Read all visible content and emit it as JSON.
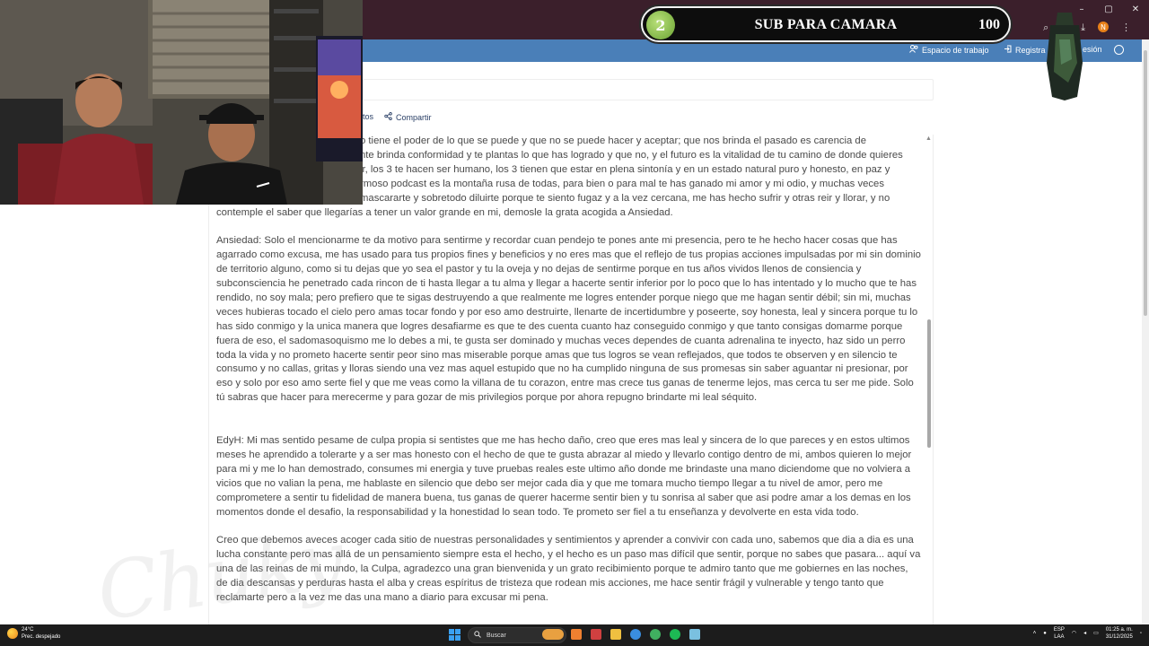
{
  "overlay": {
    "count_left": "2",
    "text": "SUB PARA CAMARA",
    "count_right": "100"
  },
  "appbar": {
    "workspace": "Espacio de trabajo",
    "register": "Registra",
    "signin_suffix": "esión"
  },
  "toolbar": {
    "partial_label": "tos",
    "share": "Compartir"
  },
  "document": {
    "p1_lines": [
      "o tiene el poder de lo que se puede y que no se puede hacer y aceptar; que nos brinda el pasado es carencia de",
      "nte brinda conformidad y te plantas lo que has logrado y que no, y el futuro es la vitalidad de tu camino de donde quieres",
      "ir, los 3 te hacen ser humano, los 3 tienen que estar en plena sintonía y en un estado natural puro y honesto, en paz y",
      "rmoso podcast es la montaña rusa de todas, para bien o para mal te has ganado mi amor y mi odio, y muchas veces",
      "mascararte y sobretodo diluirte porque te siento fugaz y a la vez cercana, me has hecho sufrir y otras reir y llorar, y no",
      "contemple el saber que llegarías a tener un valor grande en mi, demosle la grata acogida a Ansiedad."
    ],
    "p2": "Ansiedad: Solo el mencionarme te da motivo para sentirme y recordar cuan pendejo te pones ante mi presencia, pero te he hecho hacer cosas que has agarrado como excusa, me has usado para tus propios fines y beneficios y no eres mas que el reflejo de tus propias acciones impulsadas por mi sin dominio de territorio alguno, como si tu dejas que yo sea el pastor y tu la oveja y no dejas de sentirme porque en tus años vividos llenos de consiencia y subconsciencia he penetrado cada rincon de ti hasta llegar a tu alma y llegar a hacerte sentir inferior por lo poco que lo has intentado y lo mucho que te has rendido, no soy mala; pero prefiero que te sigas destruyendo a que realmente me logres entender porque niego que me hagan sentir débil; sin mi, muchas veces hubieras tocado el cielo pero amas tocar fondo y por eso amo destruirte, llenarte de incertidumbre y poseerte, soy honesta, leal y sincera porque tu lo has sido conmigo y la unica manera que logres desafiarme es que te des cuenta cuanto haz conseguido conmigo y que tanto consigas domarme porque fuera de eso, el sadomasoquismo me lo debes a mi, te gusta ser dominado y muchas veces dependes de cuanta adrenalina te inyecto, haz sido un perro toda la vida y no prometo hacerte sentir peor sino mas miserable porque amas que tus logros se vean reflejados, que todos te observen y en silencio te consumo y no callas, gritas y lloras siendo una vez mas aquel estupido que no ha cumplido ninguna de sus promesas sin saber aguantar ni presionar, por eso y solo por eso amo serte fiel y que me veas como la villana de tu corazon, entre mas crece tus ganas de tenerme lejos, mas cerca tu ser me pide. Solo tú sabras que hacer para merecerme y para gozar de mis privilegios porque por ahora repugno brindarte mi leal séquito.",
    "p3": "EdyH: Mi mas sentido pesame de culpa propia si sentistes que me has hecho daño, creo que eres mas leal y sincera de lo que pareces y en estos ultimos meses he aprendido a tolerarte y a ser mas honesto con el hecho de que te gusta abrazar al miedo y llevarlo contigo dentro de mi, ambos quieren lo mejor para mi y me lo han demostrado, consumes mi energia y tuve pruebas reales este ultimo año donde me brindaste una mano diciendome que no volviera a vicios que no valian la pena, me hablaste en silencio que debo ser mejor cada dia y que me tomara mucho tiempo llegar a tu nivel de amor, pero me comprometere a sentir tu fidelidad de manera buena, tus ganas de querer hacerme sentir bien y tu sonrisa al saber que asi podre amar a los demas en los momentos donde el desafio, la responsabilidad y la honestidad lo sean todo. Te prometo ser fiel a tu enseñanza y devolverte en esta vida todo.",
    "p4": "Creo que debemos aveces acoger cada sitio de nuestras personalidades y sentimientos y aprender a convivir con cada uno, sabemos que dia a dia es una lucha constante pero mas allá de un pensamiento siempre esta el hecho, y el hecho es un paso mas difícil que sentir, porque no sabes que pasara... aquí va una de las reinas de mi mundo, la Culpa, agradezco una gran bienvenida y un grato recibimiento porque te admiro tanto que me gobiernes en las noches, de dia descansas y perduras hasta el alba y creas espíritus de tristeza que rodean mis acciones, me hace sentir frágil y vulnerable y tengo tanto que reclamarte pero a la vez me das una mano a diario para excusar mi pena."
  },
  "watermark": "Chuky",
  "taskbar": {
    "weather_temp": "24°C",
    "weather_desc": "Prec. despejado",
    "search_label": "Buscar",
    "lang_top": "ESP",
    "lang_bottom": "LAA",
    "time": "01:25 a. m.",
    "date": "31/12/2025"
  },
  "colors": {
    "titlebar": "#3b1f2b",
    "appbar": "#4a7fb8",
    "overlay_green": "#8cc04a"
  }
}
